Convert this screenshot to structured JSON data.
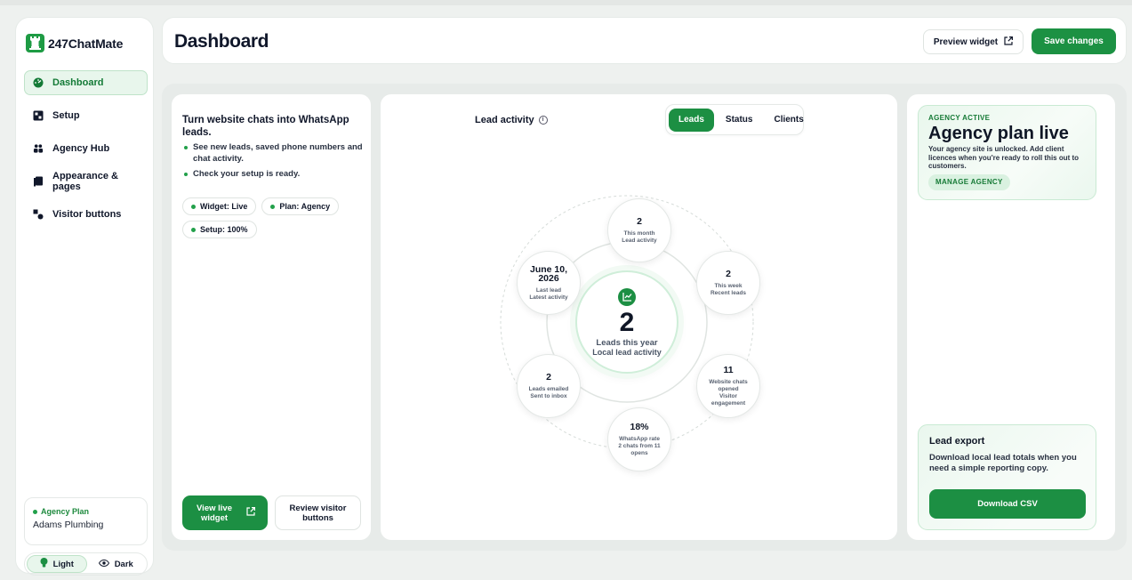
{
  "brand": {
    "name": "247ChatMate"
  },
  "sidebar": {
    "items": [
      {
        "label": "Dashboard",
        "icon": "gauge-icon",
        "active": true
      },
      {
        "label": "Setup",
        "icon": "grid-icon",
        "active": false
      },
      {
        "label": "Agency Hub",
        "icon": "team-icon",
        "active": false
      },
      {
        "label": "Appearance & pages",
        "icon": "pages-icon",
        "active": false
      },
      {
        "label": "Visitor buttons",
        "icon": "shapes-icon",
        "active": false
      }
    ],
    "plan": {
      "label": "Agency Plan",
      "name": "Adams Plumbing"
    },
    "theme": {
      "light": "Light",
      "dark": "Dark",
      "selected": "Light"
    }
  },
  "header": {
    "title": "Dashboard",
    "preview_label": "Preview widget",
    "save_label": "Save changes"
  },
  "intro": {
    "title": "Turn website chats into WhatsApp leads.",
    "bullets": [
      "See new leads, saved phone numbers and chat activity.",
      "Check your setup is ready."
    ],
    "chips": [
      "Widget: Live",
      "Plan: Agency",
      "Setup: 100%"
    ],
    "view_live_label": "View live widget",
    "review_label": "Review visitor buttons"
  },
  "activity": {
    "title": "Lead activity",
    "tabs": [
      "Leads",
      "Status",
      "Clients"
    ],
    "active_tab": "Leads",
    "center": {
      "value": "2",
      "label": "Leads this year",
      "sub": "Local lead activity"
    },
    "nodes": [
      {
        "value": "2",
        "label": "This month",
        "sub": "Lead activity"
      },
      {
        "value": "2",
        "label": "This week",
        "sub": "Recent leads"
      },
      {
        "value": "11",
        "label": "Website chats opened",
        "sub": "Visitor engagement"
      },
      {
        "value": "18%",
        "label": "WhatsApp rate",
        "sub": "2 chats from 11 opens"
      },
      {
        "value": "2",
        "label": "Leads emailed",
        "sub": "Sent to inbox"
      },
      {
        "value": "June 10, 2026",
        "label": "Last lead",
        "sub": "Latest activity"
      }
    ]
  },
  "agency": {
    "kicker": "AGENCY ACTIVE",
    "title": "Agency plan live",
    "description": "Your agency site is unlocked. Add client licences when you're ready to roll this out to customers.",
    "button_label": "MANAGE AGENCY"
  },
  "export": {
    "title": "Lead export",
    "description": "Download local lead totals when you need a simple reporting copy.",
    "button_label": "Download CSV"
  },
  "colors": {
    "accent": "#1c8f43",
    "accent_soft": "#e8f6ec",
    "text": "#10172a"
  }
}
